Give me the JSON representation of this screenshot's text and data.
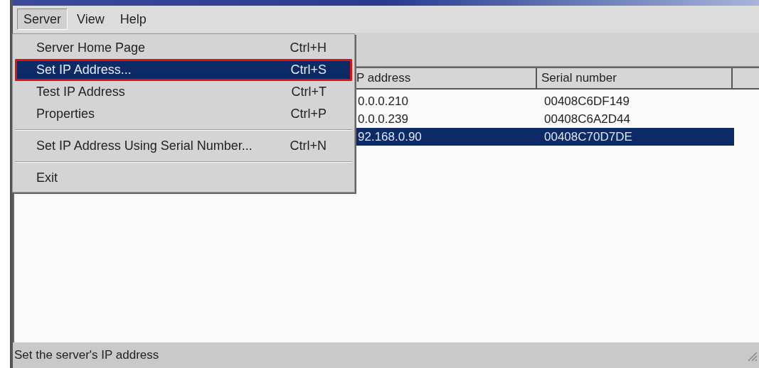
{
  "menu_bar": [
    {
      "label": "Server",
      "selected": true
    },
    {
      "label": "View",
      "selected": false
    },
    {
      "label": "Help",
      "selected": false
    }
  ],
  "server_menu": [
    {
      "kind": "item",
      "label": "Server Home Page",
      "shortcut": "Ctrl+H",
      "selected": false
    },
    {
      "kind": "item",
      "label": "Set IP Address...",
      "shortcut": "Ctrl+S",
      "selected": true
    },
    {
      "kind": "item",
      "label": "Test IP Address",
      "shortcut": "Ctrl+T",
      "selected": false
    },
    {
      "kind": "item",
      "label": "Properties",
      "shortcut": "Ctrl+P",
      "selected": false
    },
    {
      "kind": "separator"
    },
    {
      "kind": "item",
      "label": "Set IP Address Using Serial Number...",
      "shortcut": "Ctrl+N",
      "selected": false
    },
    {
      "kind": "separator"
    },
    {
      "kind": "item",
      "label": "Exit",
      "selected": false
    }
  ],
  "table": {
    "columns": [
      "P address",
      "Serial number"
    ],
    "rows": [
      {
        "cells": [
          "0.0.0.210",
          "00408C6DF149"
        ],
        "selected": false
      },
      {
        "cells": [
          "0.0.0.239",
          "00408C6A2D44"
        ],
        "selected": false
      },
      {
        "cells": [
          "92.168.0.90",
          "00408C70D7DE"
        ],
        "selected": true
      }
    ]
  },
  "status_bar": "Set the server's IP address"
}
